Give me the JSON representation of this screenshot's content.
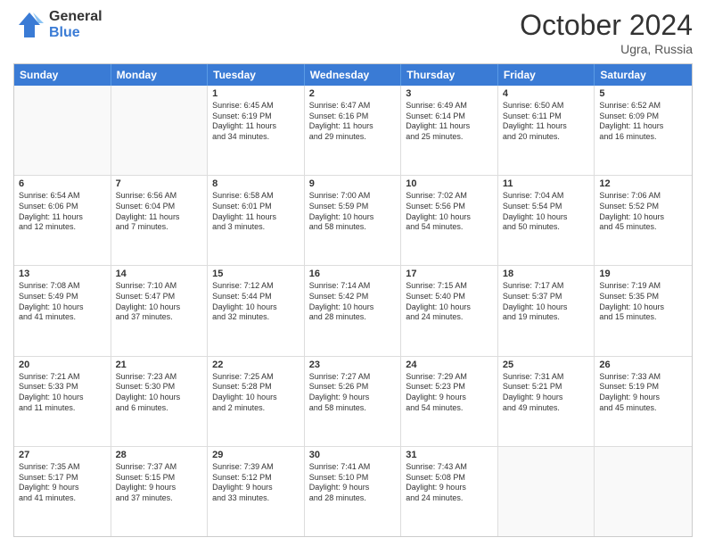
{
  "logo": {
    "general": "General",
    "blue": "Blue"
  },
  "header": {
    "month": "October 2024",
    "location": "Ugra, Russia"
  },
  "days": [
    "Sunday",
    "Monday",
    "Tuesday",
    "Wednesday",
    "Thursday",
    "Friday",
    "Saturday"
  ],
  "weeks": [
    [
      {
        "day": "",
        "sunrise": "",
        "sunset": "",
        "daylight": ""
      },
      {
        "day": "",
        "sunrise": "",
        "sunset": "",
        "daylight": ""
      },
      {
        "day": "1",
        "sunrise": "Sunrise: 6:45 AM",
        "sunset": "Sunset: 6:19 PM",
        "daylight": "Daylight: 11 hours and 34 minutes."
      },
      {
        "day": "2",
        "sunrise": "Sunrise: 6:47 AM",
        "sunset": "Sunset: 6:16 PM",
        "daylight": "Daylight: 11 hours and 29 minutes."
      },
      {
        "day": "3",
        "sunrise": "Sunrise: 6:49 AM",
        "sunset": "Sunset: 6:14 PM",
        "daylight": "Daylight: 11 hours and 25 minutes."
      },
      {
        "day": "4",
        "sunrise": "Sunrise: 6:50 AM",
        "sunset": "Sunset: 6:11 PM",
        "daylight": "Daylight: 11 hours and 20 minutes."
      },
      {
        "day": "5",
        "sunrise": "Sunrise: 6:52 AM",
        "sunset": "Sunset: 6:09 PM",
        "daylight": "Daylight: 11 hours and 16 minutes."
      }
    ],
    [
      {
        "day": "6",
        "sunrise": "Sunrise: 6:54 AM",
        "sunset": "Sunset: 6:06 PM",
        "daylight": "Daylight: 11 hours and 12 minutes."
      },
      {
        "day": "7",
        "sunrise": "Sunrise: 6:56 AM",
        "sunset": "Sunset: 6:04 PM",
        "daylight": "Daylight: 11 hours and 7 minutes."
      },
      {
        "day": "8",
        "sunrise": "Sunrise: 6:58 AM",
        "sunset": "Sunset: 6:01 PM",
        "daylight": "Daylight: 11 hours and 3 minutes."
      },
      {
        "day": "9",
        "sunrise": "Sunrise: 7:00 AM",
        "sunset": "Sunset: 5:59 PM",
        "daylight": "Daylight: 10 hours and 58 minutes."
      },
      {
        "day": "10",
        "sunrise": "Sunrise: 7:02 AM",
        "sunset": "Sunset: 5:56 PM",
        "daylight": "Daylight: 10 hours and 54 minutes."
      },
      {
        "day": "11",
        "sunrise": "Sunrise: 7:04 AM",
        "sunset": "Sunset: 5:54 PM",
        "daylight": "Daylight: 10 hours and 50 minutes."
      },
      {
        "day": "12",
        "sunrise": "Sunrise: 7:06 AM",
        "sunset": "Sunset: 5:52 PM",
        "daylight": "Daylight: 10 hours and 45 minutes."
      }
    ],
    [
      {
        "day": "13",
        "sunrise": "Sunrise: 7:08 AM",
        "sunset": "Sunset: 5:49 PM",
        "daylight": "Daylight: 10 hours and 41 minutes."
      },
      {
        "day": "14",
        "sunrise": "Sunrise: 7:10 AM",
        "sunset": "Sunset: 5:47 PM",
        "daylight": "Daylight: 10 hours and 37 minutes."
      },
      {
        "day": "15",
        "sunrise": "Sunrise: 7:12 AM",
        "sunset": "Sunset: 5:44 PM",
        "daylight": "Daylight: 10 hours and 32 minutes."
      },
      {
        "day": "16",
        "sunrise": "Sunrise: 7:14 AM",
        "sunset": "Sunset: 5:42 PM",
        "daylight": "Daylight: 10 hours and 28 minutes."
      },
      {
        "day": "17",
        "sunrise": "Sunrise: 7:15 AM",
        "sunset": "Sunset: 5:40 PM",
        "daylight": "Daylight: 10 hours and 24 minutes."
      },
      {
        "day": "18",
        "sunrise": "Sunrise: 7:17 AM",
        "sunset": "Sunset: 5:37 PM",
        "daylight": "Daylight: 10 hours and 19 minutes."
      },
      {
        "day": "19",
        "sunrise": "Sunrise: 7:19 AM",
        "sunset": "Sunset: 5:35 PM",
        "daylight": "Daylight: 10 hours and 15 minutes."
      }
    ],
    [
      {
        "day": "20",
        "sunrise": "Sunrise: 7:21 AM",
        "sunset": "Sunset: 5:33 PM",
        "daylight": "Daylight: 10 hours and 11 minutes."
      },
      {
        "day": "21",
        "sunrise": "Sunrise: 7:23 AM",
        "sunset": "Sunset: 5:30 PM",
        "daylight": "Daylight: 10 hours and 6 minutes."
      },
      {
        "day": "22",
        "sunrise": "Sunrise: 7:25 AM",
        "sunset": "Sunset: 5:28 PM",
        "daylight": "Daylight: 10 hours and 2 minutes."
      },
      {
        "day": "23",
        "sunrise": "Sunrise: 7:27 AM",
        "sunset": "Sunset: 5:26 PM",
        "daylight": "Daylight: 9 hours and 58 minutes."
      },
      {
        "day": "24",
        "sunrise": "Sunrise: 7:29 AM",
        "sunset": "Sunset: 5:23 PM",
        "daylight": "Daylight: 9 hours and 54 minutes."
      },
      {
        "day": "25",
        "sunrise": "Sunrise: 7:31 AM",
        "sunset": "Sunset: 5:21 PM",
        "daylight": "Daylight: 9 hours and 49 minutes."
      },
      {
        "day": "26",
        "sunrise": "Sunrise: 7:33 AM",
        "sunset": "Sunset: 5:19 PM",
        "daylight": "Daylight: 9 hours and 45 minutes."
      }
    ],
    [
      {
        "day": "27",
        "sunrise": "Sunrise: 7:35 AM",
        "sunset": "Sunset: 5:17 PM",
        "daylight": "Daylight: 9 hours and 41 minutes."
      },
      {
        "day": "28",
        "sunrise": "Sunrise: 7:37 AM",
        "sunset": "Sunset: 5:15 PM",
        "daylight": "Daylight: 9 hours and 37 minutes."
      },
      {
        "day": "29",
        "sunrise": "Sunrise: 7:39 AM",
        "sunset": "Sunset: 5:12 PM",
        "daylight": "Daylight: 9 hours and 33 minutes."
      },
      {
        "day": "30",
        "sunrise": "Sunrise: 7:41 AM",
        "sunset": "Sunset: 5:10 PM",
        "daylight": "Daylight: 9 hours and 28 minutes."
      },
      {
        "day": "31",
        "sunrise": "Sunrise: 7:43 AM",
        "sunset": "Sunset: 5:08 PM",
        "daylight": "Daylight: 9 hours and 24 minutes."
      },
      {
        "day": "",
        "sunrise": "",
        "sunset": "",
        "daylight": ""
      },
      {
        "day": "",
        "sunrise": "",
        "sunset": "",
        "daylight": ""
      }
    ]
  ]
}
